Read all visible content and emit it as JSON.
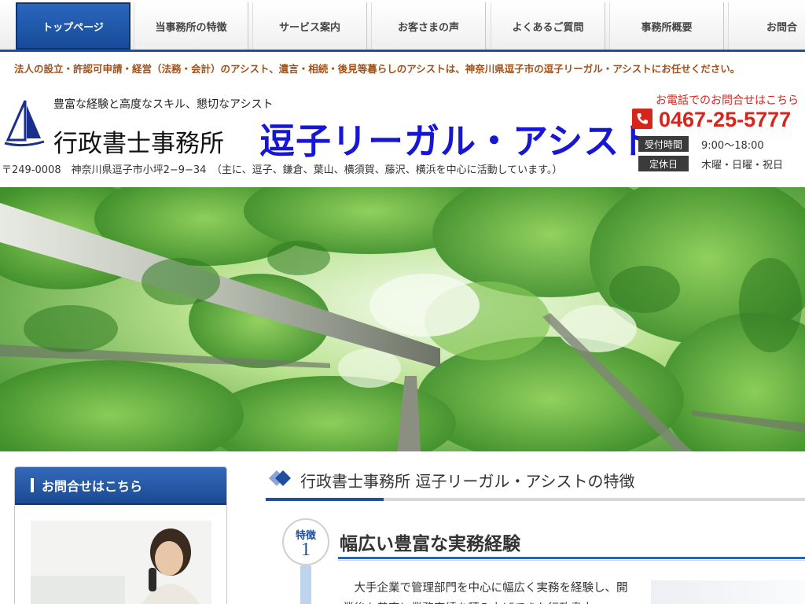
{
  "nav": {
    "items": [
      {
        "label": "トップページ"
      },
      {
        "label": "当事務所の特徴"
      },
      {
        "label": "サービス案内"
      },
      {
        "label": "お客さまの声"
      },
      {
        "label": "よくあるご質問"
      },
      {
        "label": "事務所概要"
      },
      {
        "label": "お問合"
      }
    ]
  },
  "tagline": "法人の設立・許認可申請・経営（法務・会計）のアシスト、遺言・相続・後見等暮らしのアシストは、神奈川県逗子市の逗子リーガル・アシストにお任せください。",
  "header": {
    "catchphrase": "豊富な経験と高度なスキル、懇切なアシスト",
    "office_type": "行政書士事務所",
    "brand_name": "逗子リーガル・アシスト",
    "address": "〒249-0008　神奈川県逗子市小坪2−9−34　（主に、逗子、鎌倉、葉山、横須賀、藤沢、横浜を中心に活動しています。）"
  },
  "contact": {
    "caption": "お電話でのお問合せはこちら",
    "phone": "0467-25-5777",
    "hours_label": "受付時間",
    "hours_value": "9:00〜18:00",
    "holiday_label": "定休日",
    "holiday_value": "木曜・日曜・祝日"
  },
  "sidebar": {
    "heading": "お問合せはこちら"
  },
  "main": {
    "section_title": "行政書士事務所 逗子リーガル・アシストの特徴",
    "feature": {
      "badge_label": "特徴",
      "badge_number": "1",
      "title": "幅広い豊富な実務経験",
      "body": "　大手企業で管理部門を中心に幅広く実務を経験し、開業後も着実に業務実績を積み上げてきた行政書士"
    }
  },
  "colors": {
    "nav_active": "#1d4f9e",
    "brand_blue": "#1616d4",
    "tagline_brown": "#a0521a",
    "phone_red": "#d6261c"
  }
}
